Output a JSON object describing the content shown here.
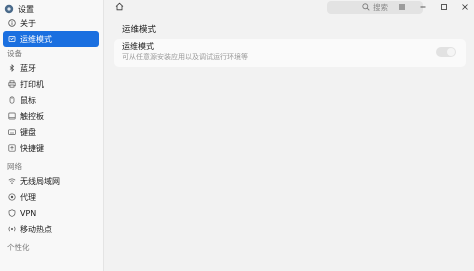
{
  "app": {
    "title": "设置"
  },
  "search": {
    "placeholder": "搜索"
  },
  "sidebar": {
    "top_items": [
      {
        "label": "关于",
        "icon": "info-icon"
      },
      {
        "label": "运维模式",
        "icon": "maintenance-icon",
        "active": true
      }
    ],
    "groups": [
      {
        "title": "设备",
        "items": [
          {
            "label": "蓝牙",
            "icon": "bluetooth-icon"
          },
          {
            "label": "打印机",
            "icon": "printer-icon"
          },
          {
            "label": "鼠标",
            "icon": "mouse-icon"
          },
          {
            "label": "触控板",
            "icon": "touchpad-icon"
          },
          {
            "label": "键盘",
            "icon": "keyboard-icon"
          },
          {
            "label": "快捷键",
            "icon": "shortcut-icon"
          }
        ]
      },
      {
        "title": "网络",
        "items": [
          {
            "label": "无线局域网",
            "icon": "wifi-icon"
          },
          {
            "label": "代理",
            "icon": "proxy-icon"
          },
          {
            "label": "VPN",
            "icon": "vpn-icon"
          },
          {
            "label": "移动热点",
            "icon": "hotspot-icon"
          }
        ]
      },
      {
        "title": "个性化",
        "items": []
      }
    ]
  },
  "main": {
    "section_title": "运维模式",
    "option": {
      "title": "运维模式",
      "description": "可从任意源安装应用以及调试运行环境等",
      "enabled": false
    }
  }
}
